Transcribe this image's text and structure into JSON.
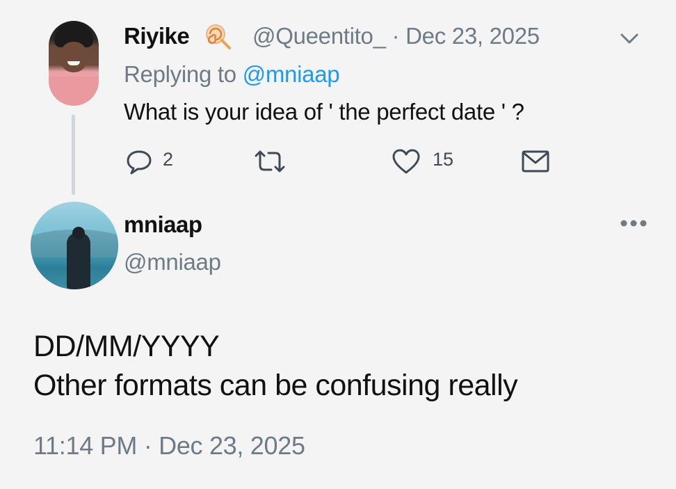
{
  "parent_tweet": {
    "author_name": "Riyike",
    "name_emoji": "lollipop-emoji",
    "handle": "@Queentito_",
    "separator": "·",
    "date": "Dec 23, 2025",
    "replying_prefix": "Replying to ",
    "replying_to": "@mniaap",
    "text": "What is your idea of ' the perfect date ' ?",
    "actions": {
      "reply_icon": "reply-icon",
      "reply_count": "2",
      "retweet_icon": "retweet-icon",
      "like_icon": "heart-icon",
      "like_count": "15",
      "dm_icon": "envelope-icon"
    },
    "menu_icon": "chevron-down-icon"
  },
  "main_tweet": {
    "author_name": "mniaap",
    "handle": "@mniaap",
    "menu_icon": "more-dots-icon",
    "text_line1": "DD/MM/YYYY",
    "text_line2": "Other formats can be confusing really",
    "time": "11:14 PM",
    "separator": "·",
    "date": "Dec 23, 2025"
  },
  "colors": {
    "background": "#f4f4f4",
    "text": "#111111",
    "muted": "#6e7b86",
    "link": "#1d9bf0",
    "thread_line": "#cfd6dc"
  }
}
